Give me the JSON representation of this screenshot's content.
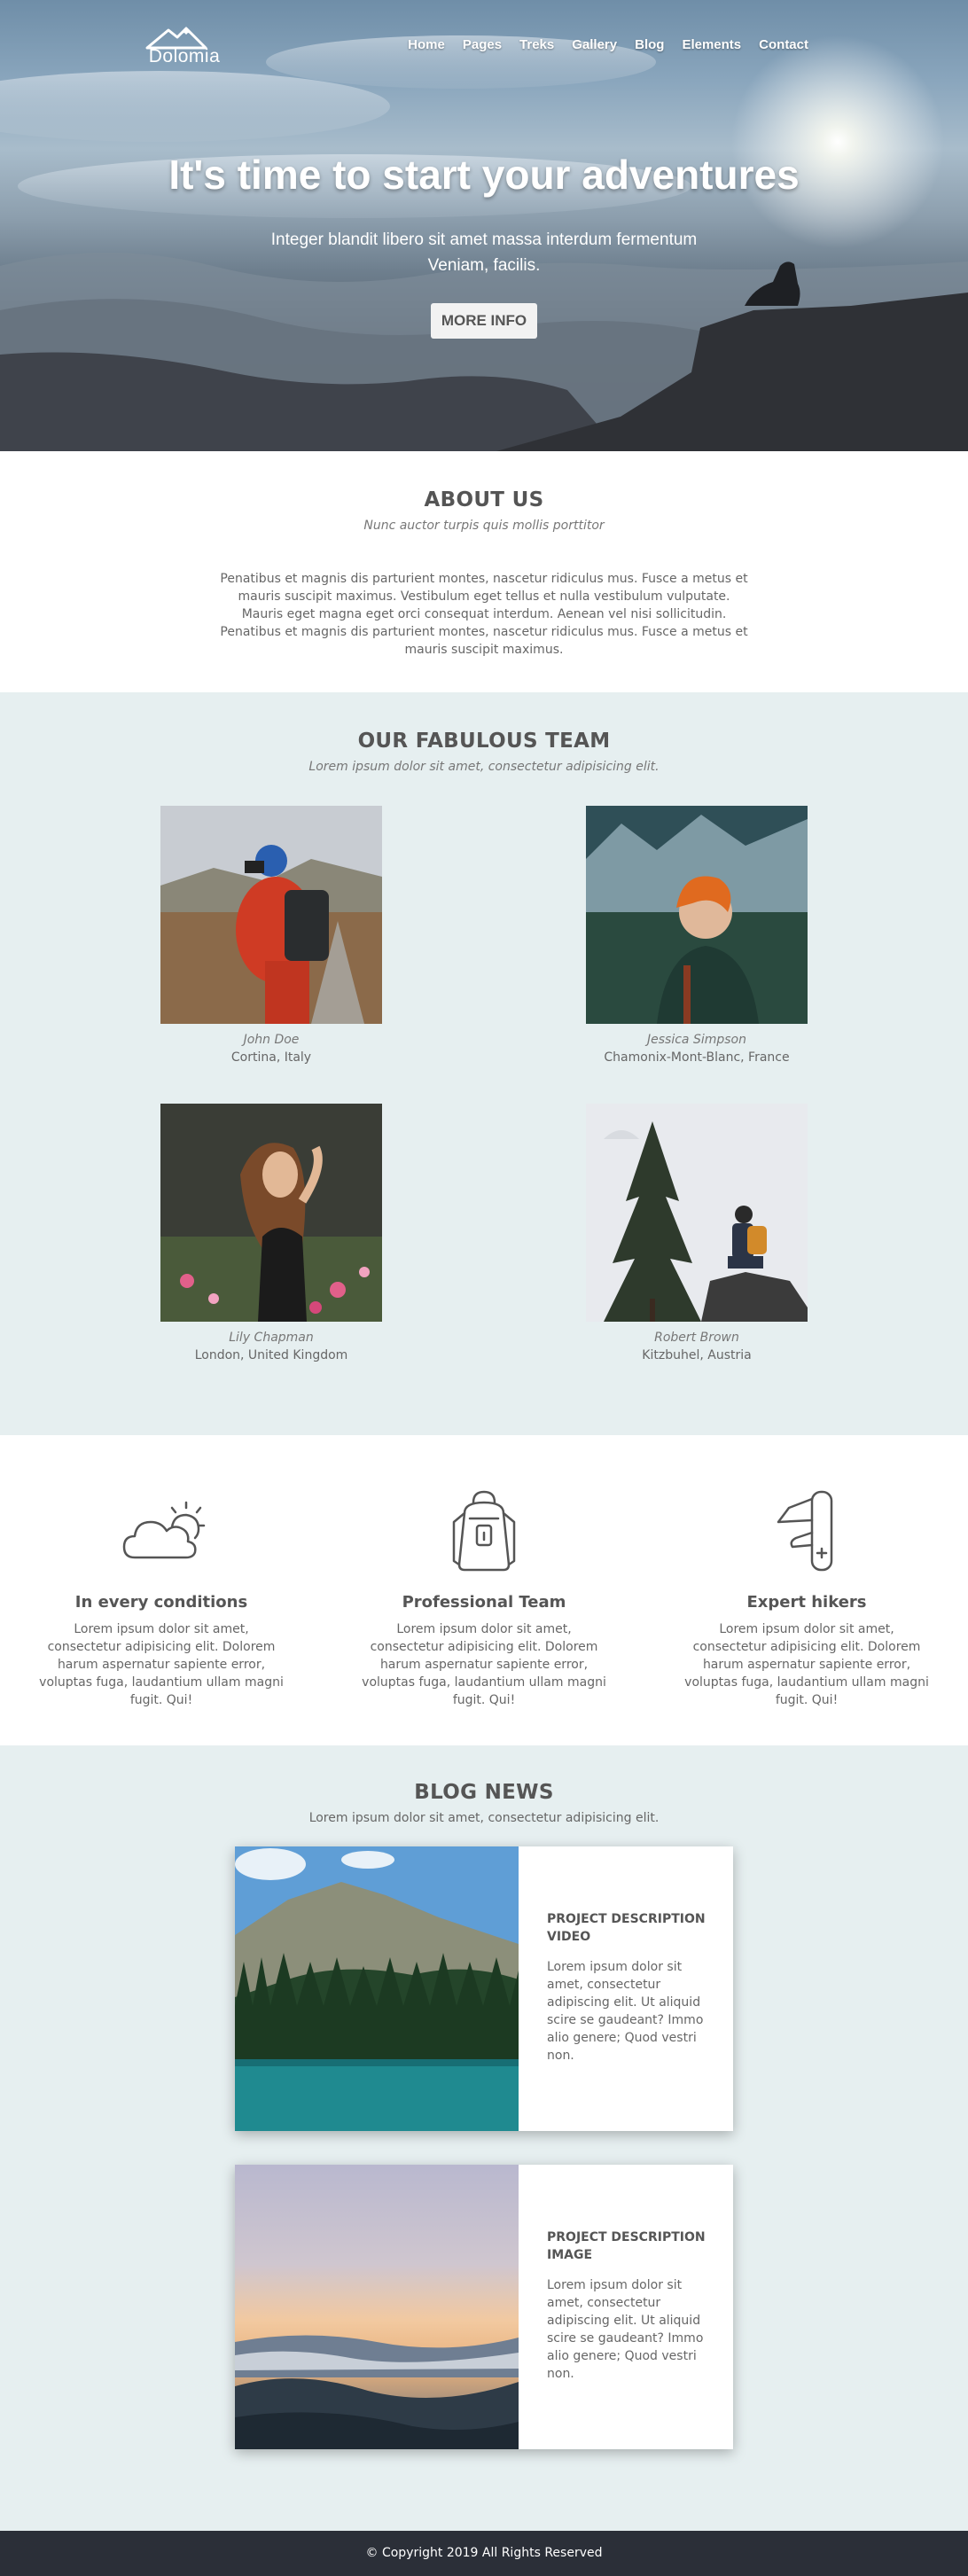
{
  "brand": {
    "name": "Dolomia"
  },
  "nav": {
    "items": [
      "Home",
      "Pages",
      "Treks",
      "Gallery",
      "Blog",
      "Elements",
      "Contact"
    ]
  },
  "hero": {
    "title": "It's time to start your adventures",
    "subtitle": "Integer blandit libero sit amet massa interdum fermentum Veniam, facilis.",
    "button": "MORE INFO"
  },
  "about": {
    "title": "ABOUT US",
    "subtitle": "Nunc auctor turpis quis mollis porttitor",
    "text": "Penatibus et magnis dis parturient montes, nascetur ridiculus mus. Fusce a metus et mauris suscipit maximus. Vestibulum eget tellus et nulla vestibulum vulputate. Mauris eget magna eget orci consequat interdum. Aenean vel nisi sollicitudin. Penatibus et magnis dis parturient montes, nascetur ridiculus mus. Fusce a metus et mauris suscipit maximus."
  },
  "team": {
    "title": "OUR FABULOUS TEAM",
    "subtitle": "Lorem ipsum dolor sit amet, consectetur adipisicing elit.",
    "members": [
      {
        "name": "John Doe",
        "location": "Cortina, Italy"
      },
      {
        "name": "Jessica Simpson",
        "location": "Chamonix-Mont-Blanc, France"
      },
      {
        "name": "Lily Chapman",
        "location": "London, United Kingdom"
      },
      {
        "name": "Robert Brown",
        "location": "Kitzbuhel, Austria"
      }
    ]
  },
  "features": [
    {
      "icon": "cloud-sun-icon",
      "title": "In every conditions",
      "text": "Lorem ipsum dolor sit amet, consectetur adipisicing elit. Dolorem harum aspernatur sapiente error, voluptas fuga, laudantium ullam magni fugit. Qui!"
    },
    {
      "icon": "backpack-icon",
      "title": "Professional Team",
      "text": "Lorem ipsum dolor sit amet, consectetur adipisicing elit. Dolorem harum aspernatur sapiente error, voluptas fuga, laudantium ullam magni fugit. Qui!"
    },
    {
      "icon": "swiss-knife-icon",
      "title": "Expert hikers",
      "text": "Lorem ipsum dolor sit amet, consectetur adipisicing elit. Dolorem harum aspernatur sapiente error, voluptas fuga, laudantium ullam magni fugit. Qui!"
    }
  ],
  "blog": {
    "title": "BLOG NEWS",
    "subtitle": "Lorem ipsum dolor sit amet, consectetur adipisicing elit.",
    "posts": [
      {
        "title": "PROJECT DESCRIPTION VIDEO",
        "text": "Lorem ipsum dolor sit amet, consectetur adipiscing elit. Ut aliquid scire se gaudeant? Immo alio genere; Quod vestri non."
      },
      {
        "title": "PROJECT DESCRIPTION IMAGE",
        "text": "Lorem ipsum dolor sit amet, consectetur adipiscing elit. Ut aliquid scire se gaudeant? Immo alio genere; Quod vestri non."
      }
    ]
  },
  "footer": {
    "copyright": "© Copyright 2019 All Rights Reserved"
  }
}
